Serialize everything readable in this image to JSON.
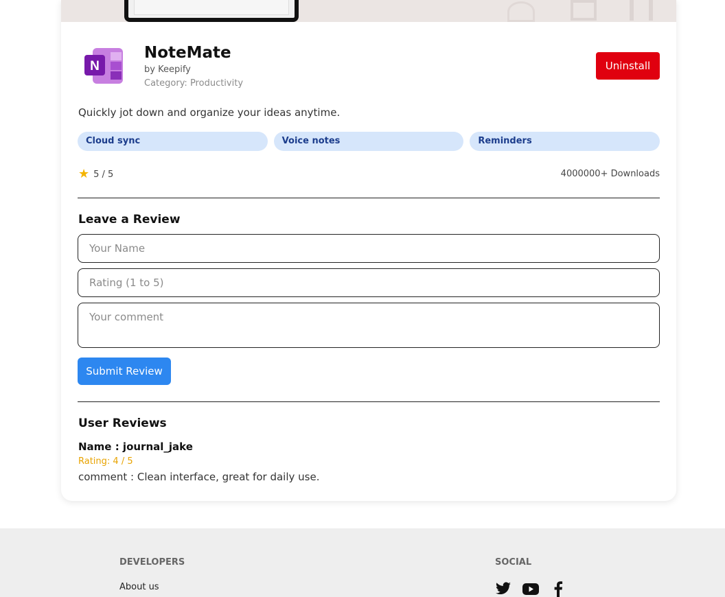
{
  "app": {
    "name": "NoteMate",
    "developer": "by Keepify",
    "category": "Category: Productivity",
    "description": "Quickly jot down and organize your ideas anytime.",
    "tags": [
      "Cloud sync",
      "Voice notes",
      "Reminders"
    ],
    "rating": "5 / 5",
    "downloads": "4000000+ Downloads",
    "uninstall_label": "Uninstall",
    "icon": "onenote-icon"
  },
  "review_form": {
    "title": "Leave a Review",
    "name_placeholder": "Your Name",
    "rating_placeholder": "Rating (1 to 5)",
    "comment_placeholder": "Your comment",
    "submit_label": "Submit Review"
  },
  "user_reviews": {
    "title": "User Reviews",
    "items": [
      {
        "name": "Name : journal_jake",
        "rating": "Rating: 4 / 5",
        "comment": "comment : Clean interface, great for daily use."
      }
    ]
  },
  "footer": {
    "developers_heading": "DEVELOPERS",
    "developers_links": [
      "About us"
    ],
    "social_heading": "SOCIAL",
    "social_icons": [
      "twitter-icon",
      "youtube-icon",
      "facebook-icon"
    ]
  },
  "colors": {
    "uninstall": "#e0000f",
    "submit": "#2d87f0",
    "tag_bg": "#d6e6fb",
    "tag_text": "#1c3d8c",
    "star": "#f4b400",
    "review_rating": "#e8a300"
  }
}
